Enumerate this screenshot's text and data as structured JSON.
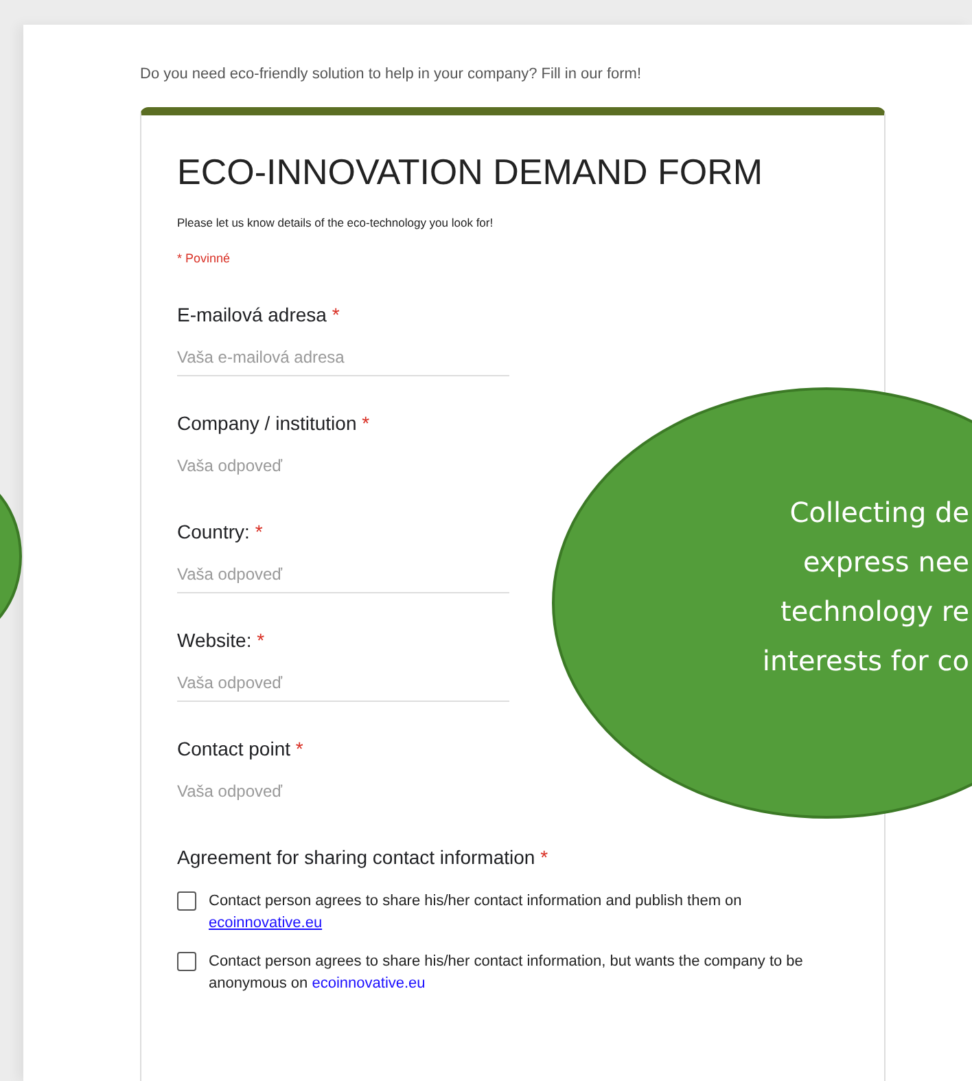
{
  "intro": "Do you need eco-friendly solution to help in your company? Fill in our form!",
  "form": {
    "title": "ECO-INNOVATION DEMAND FORM",
    "description": "Please let us know details of the eco-technology you look for!",
    "required_note": "* Povinné",
    "questions": [
      {
        "label": "E-mailová adresa",
        "required_mark": "*",
        "placeholder": "Vaša e-mailová adresa",
        "underlined": true
      },
      {
        "label": "Company / institution",
        "required_mark": "*",
        "placeholder": "Vaša odpoveď",
        "underlined": false
      },
      {
        "label": "Country:",
        "required_mark": "*",
        "placeholder": "Vaša odpoveď",
        "underlined": true
      },
      {
        "label": "Website:",
        "required_mark": "*",
        "placeholder": "Vaša odpoveď",
        "underlined": true
      },
      {
        "label": "Contact point",
        "required_mark": "*",
        "placeholder": "Vaša odpoveď",
        "underlined": false
      }
    ],
    "agreement": {
      "label": "Agreement for sharing contact information",
      "required_mark": "*",
      "options": [
        {
          "text": "Contact person agrees to share his/her contact information and publish them on",
          "link": "ecoinnovative.eu",
          "link_underlined": true,
          "checked": false
        },
        {
          "text": "Contact person agrees to share his/her contact information, but wants the company to be anonymous on",
          "link": "ecoinnovative.eu",
          "link_underlined": false,
          "checked": false
        }
      ]
    }
  },
  "callout": {
    "lines": [
      "Collecting de",
      "express nee",
      "technology re",
      "interests for co"
    ]
  }
}
